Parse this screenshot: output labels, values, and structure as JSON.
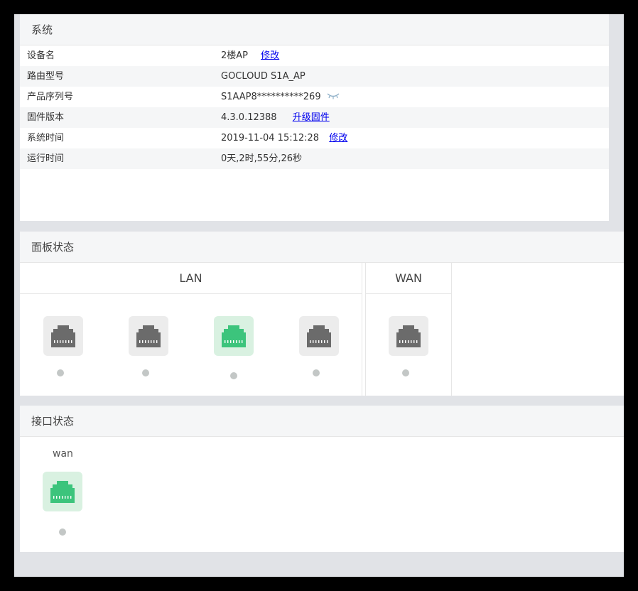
{
  "system": {
    "title": "系统",
    "rows": [
      {
        "label": "设备名",
        "value": "2楼AP",
        "link": "修改"
      },
      {
        "label": "路由型号",
        "value": "GOCLOUD S1A_AP"
      },
      {
        "label": "产品序列号",
        "value": "S1AAP8**********269",
        "icon": "eye-closed-icon"
      },
      {
        "label": "固件版本",
        "value": "4.3.0.12388",
        "link": "升级固件"
      },
      {
        "label": "系统时间",
        "value": "2019-11-04 15:12:28",
        "link": "修改"
      },
      {
        "label": "运行时间",
        "value": "0天,2时,55分,26秒"
      }
    ]
  },
  "panel_status": {
    "title": "面板状态",
    "lan": {
      "label": "LAN",
      "ports": [
        {
          "active": false
        },
        {
          "active": false
        },
        {
          "active": true
        },
        {
          "active": false
        }
      ]
    },
    "wan": {
      "label": "WAN",
      "ports": [
        {
          "active": false
        }
      ]
    }
  },
  "interface_status": {
    "title": "接口状态",
    "interfaces": [
      {
        "name": "wan",
        "active": true
      }
    ]
  },
  "colors": {
    "active_port": "#3cc47c",
    "inactive_port": "#6b6b6b",
    "link": "#0000ee"
  }
}
